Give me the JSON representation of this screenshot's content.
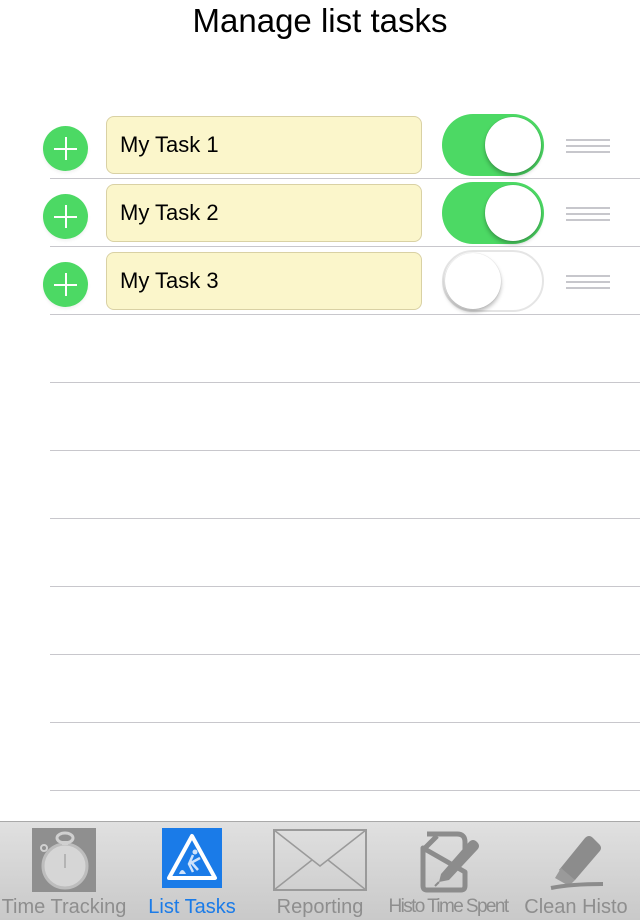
{
  "header": {
    "title": "Manage list tasks"
  },
  "tasks": [
    {
      "name": "My Task 1",
      "enabled": true
    },
    {
      "name": "My Task 2",
      "enabled": true
    },
    {
      "name": "My Task 3",
      "enabled": false
    }
  ],
  "empty_rows": 7,
  "colors": {
    "accent_green": "#4cd964",
    "task_field_bg": "#fbf6cb",
    "tab_active": "#1a7be8",
    "tab_inactive": "#8e8e8e"
  },
  "tabbar": {
    "active_index": 1,
    "tabs": [
      {
        "label": "Time Tracking",
        "icon": "stopwatch-icon"
      },
      {
        "label": "List Tasks",
        "icon": "road-work-sign-icon"
      },
      {
        "label": "Reporting",
        "icon": "envelope-icon"
      },
      {
        "label": "Histo Time Spent",
        "icon": "document-pencil-icon"
      },
      {
        "label": "Clean Histo",
        "icon": "eraser-icon"
      }
    ]
  }
}
